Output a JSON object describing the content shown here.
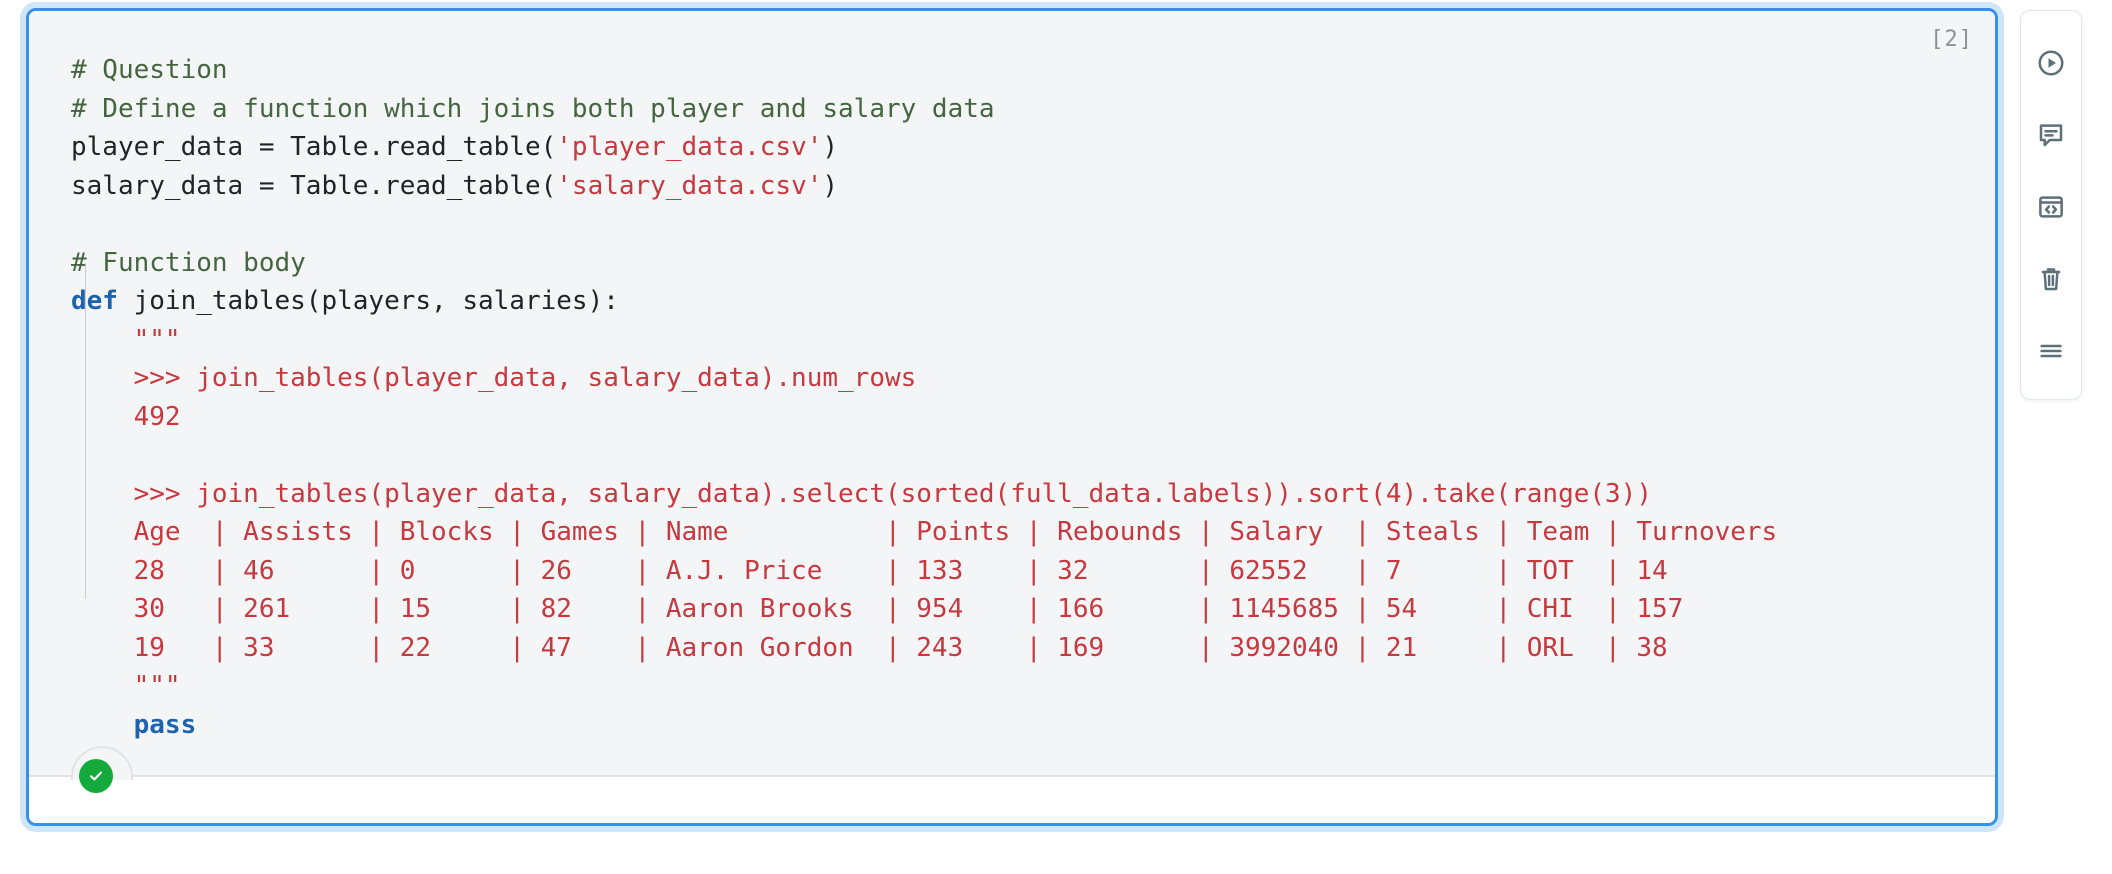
{
  "cell": {
    "execution_count": "[2]",
    "status": {
      "icon": "check-circle-icon",
      "label": "ok",
      "color": "#14ab3c"
    },
    "border_color": "#3590f0",
    "background": "#f4f5f7",
    "language": "python",
    "code_lines": [
      [
        {
          "t": "# Question",
          "c": "cm"
        }
      ],
      [
        {
          "t": "# Define a function which joins both player and salary data",
          "c": "cm"
        }
      ],
      [
        {
          "t": "player_data = Table.read_table(",
          "c": "plain"
        },
        {
          "t": "'player_data.csv'",
          "c": "str"
        },
        {
          "t": ")",
          "c": "plain"
        }
      ],
      [
        {
          "t": "salary_data = Table.read_table(",
          "c": "plain"
        },
        {
          "t": "'salary_data.csv'",
          "c": "str"
        },
        {
          "t": ")",
          "c": "plain"
        }
      ],
      [
        {
          "t": "",
          "c": "plain"
        }
      ],
      [
        {
          "t": "# Function body",
          "c": "cm"
        }
      ],
      [
        {
          "t": "def",
          "c": "kw"
        },
        {
          "t": " join_tables(players, salaries):",
          "c": "plain"
        }
      ],
      [
        {
          "t": "    \"\"\"",
          "c": "str"
        }
      ],
      [
        {
          "t": "    >>> join_tables(player_data, salary_data).num_rows",
          "c": "str"
        }
      ],
      [
        {
          "t": "    492",
          "c": "str"
        }
      ],
      [
        {
          "t": "",
          "c": "str"
        }
      ],
      [
        {
          "t": "    >>> join_tables(player_data, salary_data).select(sorted(full_data.labels)).sort(4).take(range(3))",
          "c": "str"
        }
      ],
      [
        {
          "t": "    Age  | Assists | Blocks | Games | Name          | Points | Rebounds | Salary  | Steals | Team | Turnovers",
          "c": "str"
        }
      ],
      [
        {
          "t": "    28   | 46      | 0      | 26    | A.J. Price    | 133    | 32       | 62552   | 7      | TOT  | 14",
          "c": "str"
        }
      ],
      [
        {
          "t": "    30   | 261     | 15     | 82    | Aaron Brooks  | 954    | 166      | 1145685 | 54     | CHI  | 157",
          "c": "str"
        }
      ],
      [
        {
          "t": "    19   | 33      | 22     | 47    | Aaron Gordon  | 243    | 169      | 3992040 | 21     | ORL  | 38",
          "c": "str"
        }
      ],
      [
        {
          "t": "    \"\"\"",
          "c": "str"
        }
      ],
      [
        {
          "t": "    ",
          "c": "plain"
        },
        {
          "t": "pass",
          "c": "kw"
        }
      ]
    ],
    "doctest_table": {
      "type": "table",
      "headers": [
        "Age",
        "Assists",
        "Blocks",
        "Games",
        "Name",
        "Points",
        "Rebounds",
        "Salary",
        "Steals",
        "Team",
        "Turnovers"
      ],
      "rows": [
        [
          "28",
          "46",
          "0",
          "26",
          "A.J. Price",
          "133",
          "32",
          "62552",
          "7",
          "TOT",
          "14"
        ],
        [
          "30",
          "261",
          "15",
          "82",
          "Aaron Brooks",
          "954",
          "166",
          "1145685",
          "54",
          "CHI",
          "157"
        ],
        [
          "19",
          "33",
          "22",
          "47",
          "Aaron Gordon",
          "243",
          "169",
          "3992040",
          "21",
          "ORL",
          "38"
        ]
      ],
      "num_rows_result": "492"
    }
  },
  "toolbar": {
    "buttons": [
      {
        "icon": "play-circle-icon",
        "label": "Run cell"
      },
      {
        "icon": "comment-icon",
        "label": "Add comment"
      },
      {
        "icon": "code-window-icon",
        "label": "View code snippet"
      },
      {
        "icon": "trash-icon",
        "label": "Delete cell"
      },
      {
        "icon": "menu-icon",
        "label": "More options"
      }
    ]
  }
}
